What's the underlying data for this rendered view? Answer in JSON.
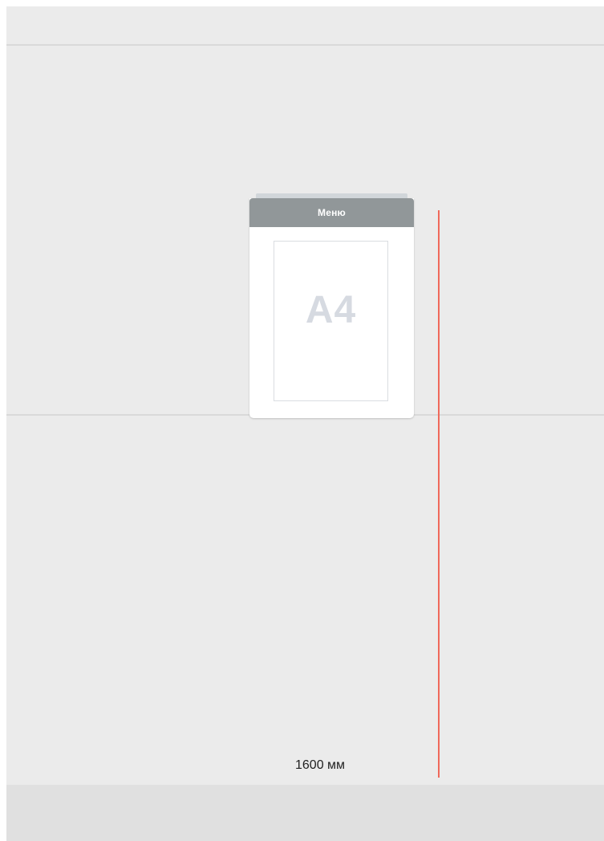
{
  "menu_holder": {
    "header_label": "Меню",
    "sheet_label": "A4",
    "header_color": "#919799",
    "sheet_label_color": "#d6dae1"
  },
  "measurement": {
    "label": "1600 мм",
    "line_color": "#f0695a"
  },
  "colors": {
    "wall": "#ebebeb",
    "floor": "#e0e0e0",
    "guide_line": "#d9d9d9",
    "text": "#222222"
  }
}
